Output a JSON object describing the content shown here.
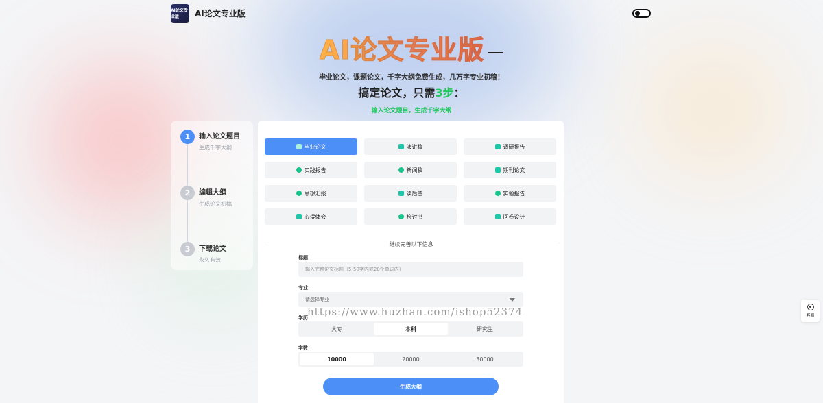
{
  "header": {
    "logo_text": "AI论文专业版",
    "site_name": "AI论文专业版"
  },
  "hero": {
    "title": "AI论文专业版",
    "subtitle": "毕业论文，课题论文，千字大纲免费生成，几万字专业初稿！",
    "steps_prefix": "搞定论文，只需",
    "steps_number": "3步",
    "steps_suffix": "：",
    "step_hint": "输入论文题目，生成千字大纲"
  },
  "steps": [
    {
      "number": "1",
      "title": "输入论文题目",
      "desc": "生成千字大纲"
    },
    {
      "number": "2",
      "title": "编辑大纲",
      "desc": "生成论文初稿"
    },
    {
      "number": "3",
      "title": "下载论文",
      "desc": "永久有效"
    }
  ],
  "types": [
    {
      "label": "毕业论文"
    },
    {
      "label": "演讲稿"
    },
    {
      "label": "调研报告"
    },
    {
      "label": "实践报告"
    },
    {
      "label": "新闻稿"
    },
    {
      "label": "期刊论文"
    },
    {
      "label": "思想汇报"
    },
    {
      "label": "读后感"
    },
    {
      "label": "实验报告"
    },
    {
      "label": "心得体会"
    },
    {
      "label": "检讨书"
    },
    {
      "label": "问卷设计"
    }
  ],
  "form": {
    "divider": "继续完善以下信息",
    "title_label": "标题",
    "title_placeholder": "输入完整论文标题（5-50字内或20个单词内）",
    "major_label": "专业",
    "major_placeholder": "请选择专业",
    "education_label": "学历",
    "education_options": [
      "大专",
      "本科",
      "研究生"
    ],
    "education_selected": "本科",
    "wordcount_label": "字数",
    "wordcount_options": [
      "10000",
      "20000",
      "30000"
    ],
    "wordcount_selected": "10000",
    "submit_label": "生成大纲"
  },
  "watermark": "https://www.huzhan.com/ishop52374",
  "support": {
    "label": "客服"
  },
  "colors": {
    "accent": "#4b8ff7",
    "green": "#22c55e"
  }
}
